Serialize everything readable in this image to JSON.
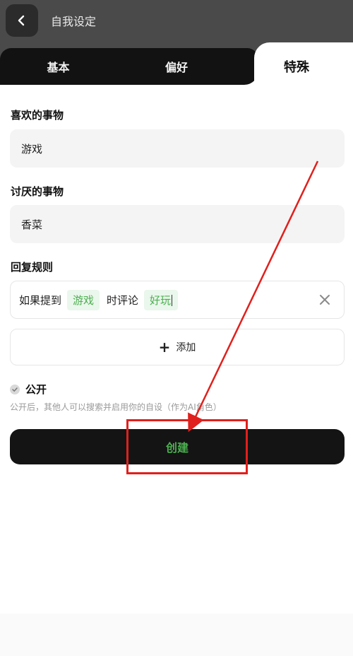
{
  "header": {
    "title": "自我设定"
  },
  "tabs": [
    {
      "label": "基本",
      "active": false
    },
    {
      "label": "偏好",
      "active": false
    },
    {
      "label": "特殊",
      "active": true
    }
  ],
  "likes": {
    "label": "喜欢的事物",
    "value": "游戏"
  },
  "dislikes": {
    "label": "讨厌的事物",
    "value": "香菜"
  },
  "reply_rule": {
    "label": "回复规则",
    "prefix": "如果提到",
    "keyword": "游戏",
    "middle": "时评论",
    "comment": "好玩"
  },
  "add_button": {
    "label": "添加"
  },
  "public": {
    "label": "公开",
    "hint": "公开后，其他人可以搜索并启用你的自设（作为AI角色）"
  },
  "create_button": {
    "label": "创建"
  },
  "colors": {
    "accent": "#4caf50",
    "annotation_red": "#e0201c",
    "dark": "#141414"
  }
}
